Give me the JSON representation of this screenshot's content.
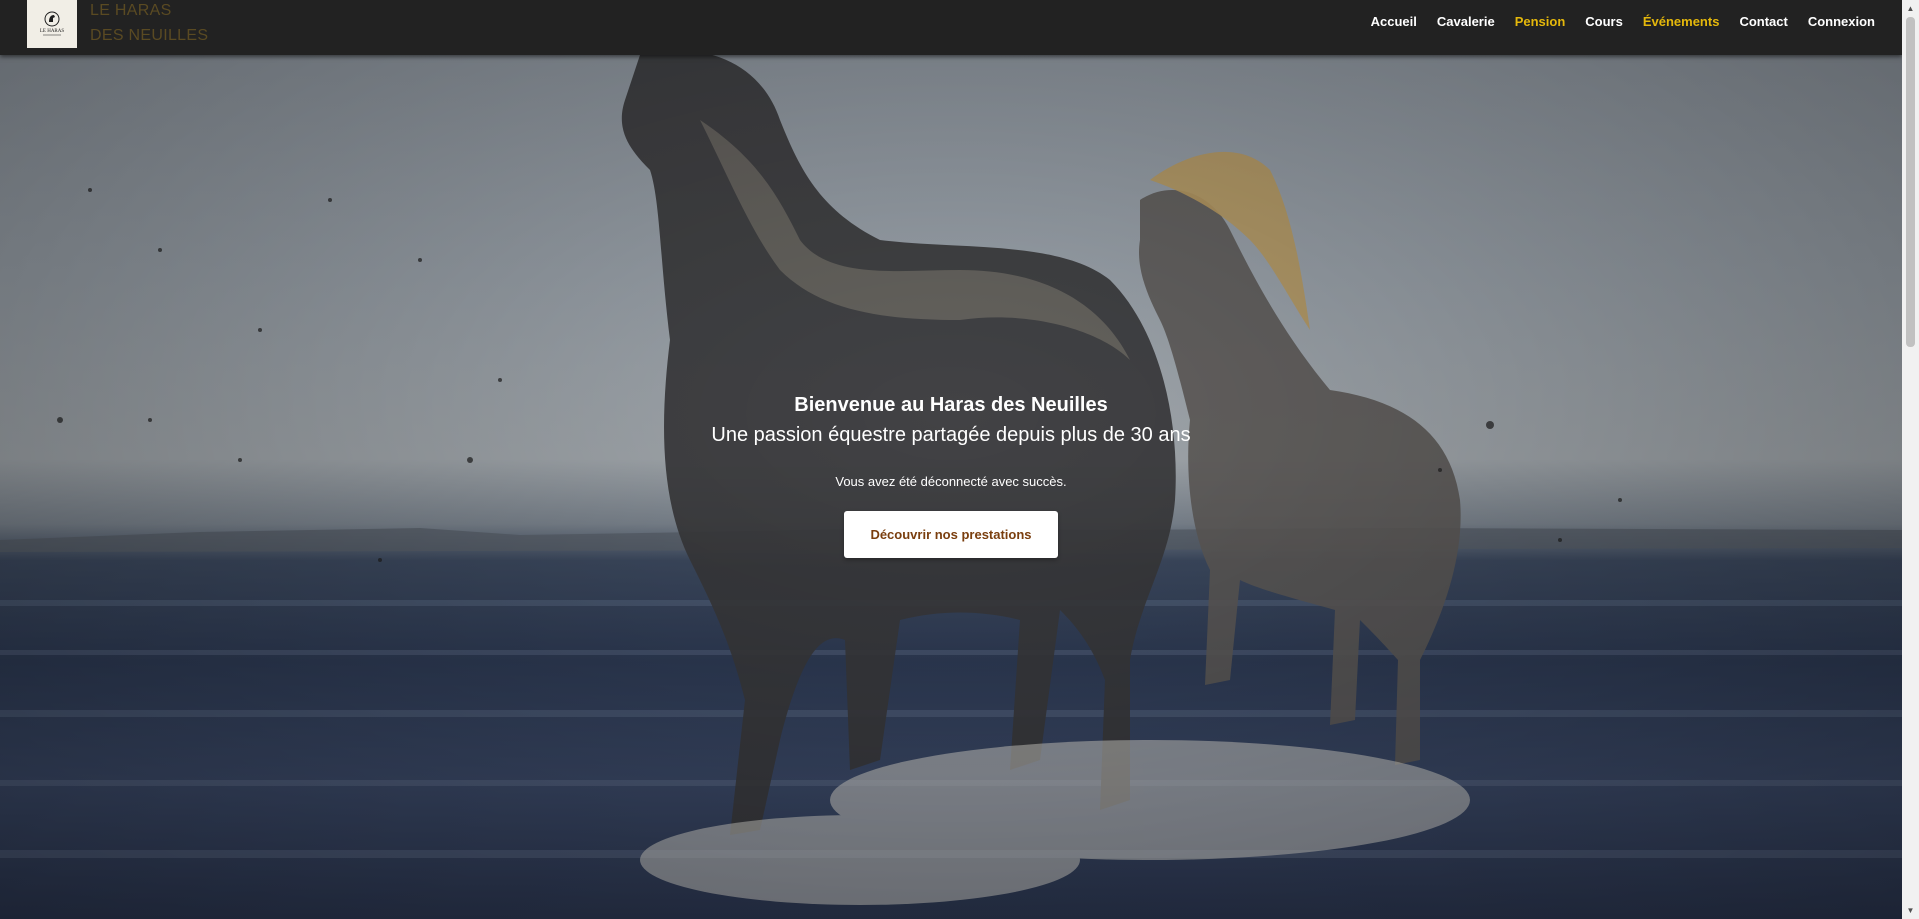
{
  "brand": {
    "logo_text": "LE HARAS",
    "line1": "LE HARAS",
    "line2": "DES NEUILLES"
  },
  "nav": {
    "items": [
      {
        "label": "Accueil",
        "color": "#ffffff"
      },
      {
        "label": "Cavalerie",
        "color": "#ffffff"
      },
      {
        "label": "Pension",
        "color": "#e5b80b"
      },
      {
        "label": "Cours",
        "color": "#ffffff"
      },
      {
        "label": "Événements",
        "color": "#e5b80b"
      },
      {
        "label": "Contact",
        "color": "#ffffff"
      },
      {
        "label": "Connexion",
        "color": "#ffffff"
      }
    ]
  },
  "hero": {
    "title": "Bienvenue au Haras des Neuilles",
    "subtitle": "Une passion équestre partagée depuis plus de 30 ans",
    "flash_message": "Vous avez été déconnecté avec succès.",
    "cta_label": "Découvrir nos prestations",
    "background_image": "horses-running-in-water"
  },
  "colors": {
    "navbar_bg": "#222222",
    "accent_gold": "#e5b80b",
    "cta_text": "#7a3e0e",
    "brand_text": "#5a4a22"
  },
  "scrollbar": {
    "up_icon": "scroll-up-arrow-icon",
    "down_icon": "scroll-down-arrow-icon"
  }
}
